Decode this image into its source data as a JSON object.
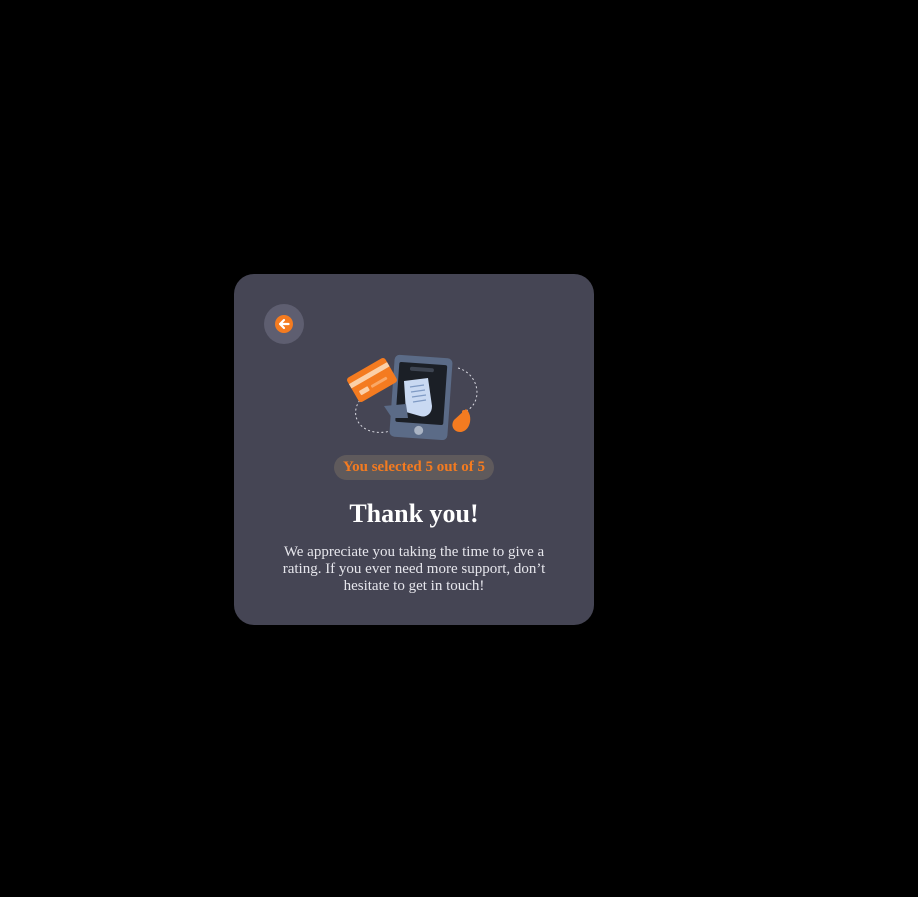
{
  "card": {
    "back_button": {
      "icon": "arrow-left-icon",
      "accent": "#f47b20"
    },
    "illustration": "payment-phone-card-receipt",
    "badge_text": "You selected 5 out of 5",
    "selected_rating": 5,
    "max_rating": 5,
    "title": "Thank you!",
    "message": "We appreciate you taking the time to give a rating. If you ever need more support, don’t hesitate to get in touch!"
  },
  "colors": {
    "background": "#000000",
    "card": "#454554",
    "accent": "#f47b20",
    "badge_bg": "#5f5a5c"
  }
}
